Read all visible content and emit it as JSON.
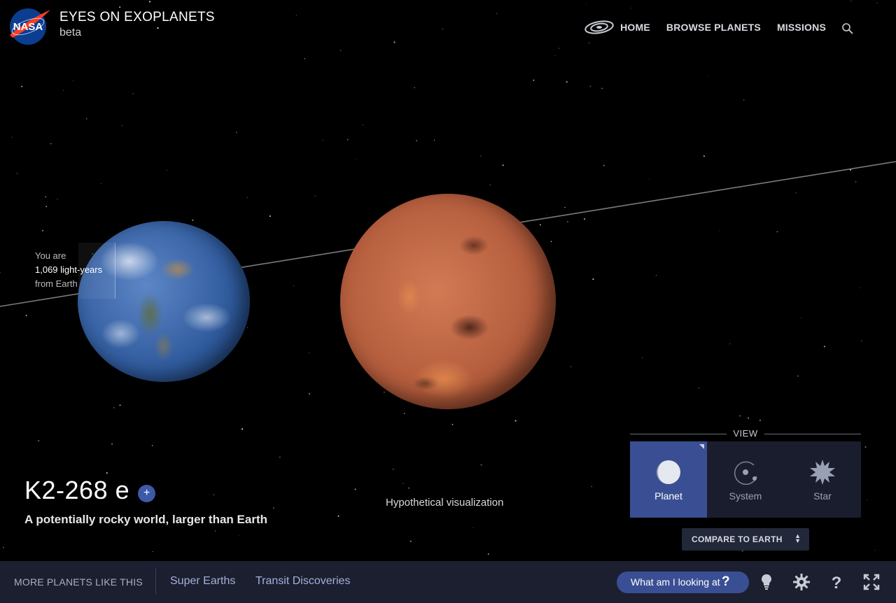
{
  "header": {
    "logo_text": "NASA",
    "title": "EYES ON EXOPLANETS",
    "subtitle": "beta"
  },
  "nav": {
    "galaxy_icon": "galaxy-icon",
    "items": [
      "HOME",
      "BROWSE PLANETS",
      "MISSIONS"
    ],
    "search_icon": "search-icon"
  },
  "distance": {
    "line1": "You are",
    "line2": "1,069 light-years",
    "line3": "from Earth"
  },
  "planet": {
    "name": "K2-268 e",
    "add_label": "+",
    "description": "A potentially rocky world, larger than Earth",
    "visualization_note": "Hypothetical visualization"
  },
  "view": {
    "label": "VIEW",
    "options": [
      {
        "label": "Planet",
        "icon": "planet-icon",
        "active": true
      },
      {
        "label": "System",
        "icon": "system-icon",
        "active": false
      },
      {
        "label": "Star",
        "icon": "star-icon",
        "active": false
      }
    ],
    "compare_label": "COMPARE TO EARTH",
    "compare_icon": "sort-arrows-icon"
  },
  "bottombar": {
    "more_label": "MORE PLANETS LIKE THIS",
    "categories": [
      "Super Earths",
      "Transit Discoveries"
    ],
    "help_label": "What am I looking at",
    "help_icon": "question-icon",
    "tools": [
      "lightbulb-icon",
      "gear-icon",
      "help-icon",
      "fullscreen-icon"
    ]
  },
  "colors": {
    "accent": "#3a4f93",
    "panel": "#1a1d2e",
    "bar": "#1c1f30"
  }
}
